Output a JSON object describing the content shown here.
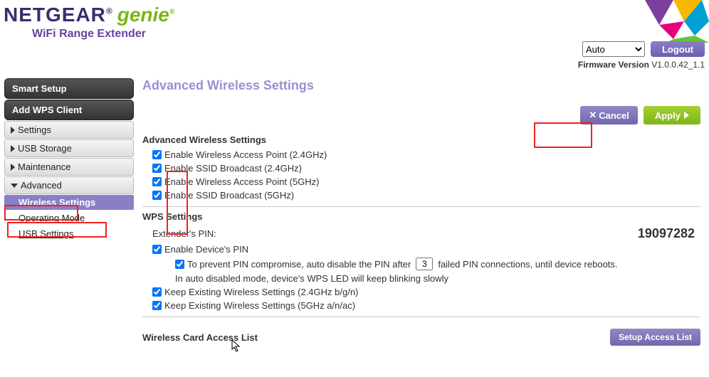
{
  "header": {
    "brand": "NETGEAR",
    "genie": "genie",
    "subtitle": "WiFi Range Extender",
    "lang_selected": "Auto",
    "logout": "Logout",
    "firmware_label": "Firmware Version",
    "firmware_value": "V1.0.0.42_1.1"
  },
  "sidebar": {
    "smart_setup": "Smart Setup",
    "add_wps": "Add WPS Client",
    "settings": "Settings",
    "usb_storage": "USB Storage",
    "maintenance": "Maintenance",
    "advanced": "Advanced",
    "subs": {
      "wireless_settings": "Wireless Settings",
      "operating_mode": "Operating Mode",
      "usb_settings": "USB Settings"
    }
  },
  "page": {
    "title": "Advanced Wireless Settings",
    "cancel": "Cancel",
    "apply": "Apply"
  },
  "aws": {
    "heading": "Advanced Wireless Settings",
    "opts": [
      "Enable Wireless Access Point (2.4GHz)",
      "Enable SSID Broadcast (2.4GHz)",
      "Enable Wireless Access Point (5GHz)",
      "Enable SSID Broadcast (5GHz)"
    ]
  },
  "wps": {
    "heading": "WPS Settings",
    "pin_label": "Extender's PIN:",
    "pin_value": "19097282",
    "enable_pin": "Enable Device's PIN",
    "prevent_prefix": "To prevent PIN compromise, auto disable the PIN after",
    "prevent_value": "3",
    "prevent_suffix": "failed PIN connections, until device reboots.",
    "auto_disabled_note": "In auto disabled mode, device's WPS LED will keep blinking slowly",
    "keep24": "Keep Existing Wireless Settings (2.4GHz b/g/n)",
    "keep5": "Keep Existing Wireless Settings (5GHz a/n/ac)"
  },
  "access": {
    "heading": "Wireless Card Access List",
    "btn": "Setup Access List"
  }
}
